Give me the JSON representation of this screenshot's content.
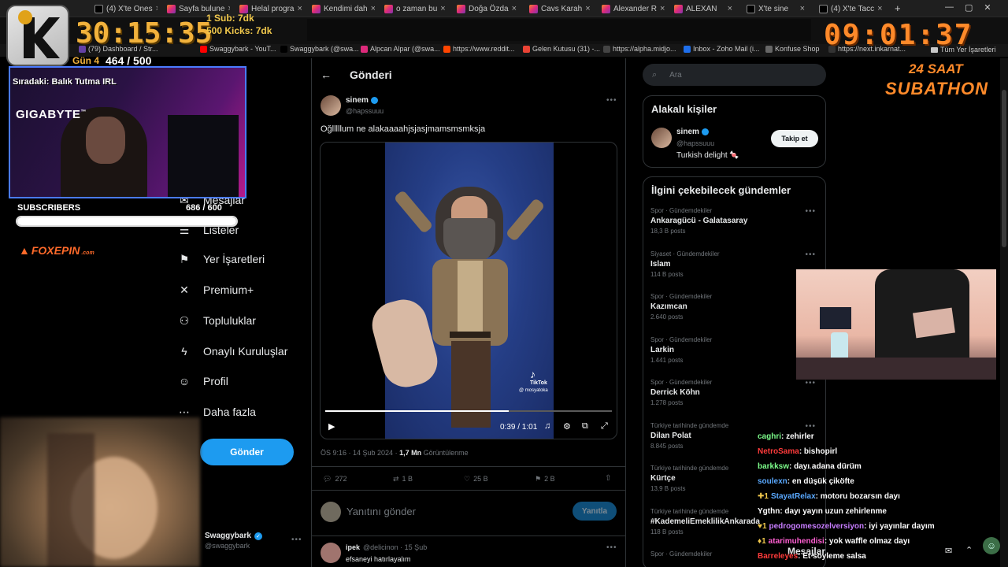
{
  "browser": {
    "tabs": [
      {
        "label": "(4) X'te Ones",
        "icon": "x"
      },
      {
        "label": "Sayfa bulune",
        "icon": "ig"
      },
      {
        "label": "Helal progra",
        "icon": "ig"
      },
      {
        "label": "Kendimi dah",
        "icon": "ig"
      },
      {
        "label": "o zaman bu",
        "icon": "ig"
      },
      {
        "label": "Doğa Özda",
        "icon": "ig"
      },
      {
        "label": "Cavs Karah",
        "icon": "ig"
      },
      {
        "label": "Alexander R",
        "icon": "ig"
      },
      {
        "label": "ALEXAN",
        "icon": "ig"
      },
      {
        "label": "X'te sine",
        "icon": "x"
      },
      {
        "label": "(4) X'te Tacc",
        "icon": "x"
      }
    ],
    "new_tab": "+",
    "bookmarks": [
      "(79) Dashboard / Str...",
      "Swaggybark - YouT...",
      "Swaggybark (@swa...",
      "Alpcan Alpar (@swa...",
      "https://www.reddit...",
      "Gelen Kutusu (31) -...",
      "https://alpha.midjo...",
      "Inbox - Zoho Mail (i...",
      "Konfuse Shop",
      "https://next.inkarnat..."
    ],
    "all_bookmarks": "Tüm Yer İşaretleri"
  },
  "stream": {
    "subathon_timer": "30:15:35",
    "sub_rule": "1 Sub: 7dk",
    "kick_rule": "500 Kicks: 7dk",
    "day_label": "Gün 4",
    "day_progress": "464 / 500",
    "clock": "09:01:37",
    "subathon_line1": "24 SAAT",
    "subathon_line2": "SUBATHON",
    "next_up": "Sıradaki: Balık Tutma IRL",
    "sponsor": "GIGABYTE",
    "sponsor_tm": "™",
    "subscribers_label": "SUBSCRIBERS",
    "subscribers_count": "686  /  600",
    "subscribers_fill": 1.0,
    "sponsor2": "FOXEPIN",
    "sponsor2_sub": ".com"
  },
  "x": {
    "nav": [
      {
        "label": "Mesajlar",
        "icon": "mail-icon"
      },
      {
        "label": "Listeler",
        "icon": "list-icon"
      },
      {
        "label": "Yer İşaretleri",
        "icon": "bookmark-icon"
      },
      {
        "label": "Premium+",
        "icon": "x-logo-icon"
      },
      {
        "label": "Topluluklar",
        "icon": "communities-icon"
      },
      {
        "label": "Onaylı Kuruluşlar",
        "icon": "lightning-icon"
      },
      {
        "label": "Profil",
        "icon": "profile-icon"
      },
      {
        "label": "Daha fazla",
        "icon": "more-icon"
      }
    ],
    "post_button": "Gönder",
    "account_name": "Swaggybark",
    "account_handle": "@swaggybark",
    "header_title": "Gönderi",
    "tweet": {
      "name": "sinem",
      "handle": "@hapssuuu",
      "text": "Oğlllllum ne alakaaaahjsjasjmamsmsmksja",
      "video_time": "0:39 / 1:01",
      "video_progress": 0.64,
      "tiktok_label": "TikTok",
      "tiktok_user": "@ mosyatoka",
      "timestamp": "ÖS 9:16 · 14 Şub 2024 · ",
      "views_count": "1,7 Mn",
      "views_label": " Görüntülenme",
      "replies": "272",
      "retweets": "1 B",
      "likes": "25 B",
      "bookmarks": "2 B"
    },
    "reply_placeholder": "Yanıtını gönder",
    "reply_button": "Yanıtla",
    "reply": {
      "name": "ipek",
      "handle": "@delicinon · 15 Şub",
      "text": "efsaneyi hatırlayalım"
    },
    "search_placeholder": "Ara",
    "related_title": "Alakalı kişiler",
    "related_user": {
      "name": "sinem",
      "handle": "@hapssuuu",
      "bio": "Turkish delight 🍬",
      "follow": "Takip et"
    },
    "trends_title": "İlgini çekebilecek gündemler",
    "trends": [
      {
        "cat": "Spor · Gündemdekiler",
        "name": "Ankaragücü - Galatasaray",
        "count": "18,3 B posts"
      },
      {
        "cat": "Siyaset · Gündemdekiler",
        "name": "Islam",
        "count": "114 B posts"
      },
      {
        "cat": "Spor · Gündemdekiler",
        "name": "Kazımcan",
        "count": "2.640 posts"
      },
      {
        "cat": "Spor · Gündemdekiler",
        "name": "Larkin",
        "count": "1.441 posts"
      },
      {
        "cat": "Spor · Gündemdekiler",
        "name": "Derrick Köhn",
        "count": "1.278 posts"
      },
      {
        "cat": "Türkiye tarihinde gündemde",
        "name": "Dilan Polat",
        "count": "8.845 posts"
      },
      {
        "cat": "Türkiye tarihinde gündemde",
        "name": "Kürtçe",
        "count": "13,9 B posts"
      },
      {
        "cat": "Türkiye tarihinde gündemde",
        "name": "#KademeliEmeklilikAnkarada",
        "count": "118 B posts"
      },
      {
        "cat": "Spor · Gündemdekiler",
        "name": "",
        "count": ""
      }
    ],
    "messages_label": "Mesajlar"
  },
  "chat": [
    {
      "user": "caghri",
      "msg": ": zehirler",
      "color": "#7cfc8a",
      "badge": ""
    },
    {
      "user": "NetroSama",
      "msg": ": bishopirl",
      "color": "#ff3b3b",
      "badge": ""
    },
    {
      "user": "barkksw",
      "msg": ": dayı adana dürüm",
      "color": "#7cfc8a",
      "badge": ""
    },
    {
      "user": "soulexn",
      "msg": ": en düşük çiköfte",
      "color": "#5aa9ff",
      "badge": ""
    },
    {
      "user": "StayatRelax",
      "msg": ": motoru bozarsın dayı",
      "color": "#5aa9ff",
      "badge": "✚1"
    },
    {
      "user": "Ygthn",
      "msg": ": dayı yayın uzun zehirlenme",
      "color": "#ffffff",
      "badge": ""
    },
    {
      "user": "pedrogomesozelversiyon",
      "msg": ": iyi yayınlar dayım",
      "color": "#c77dff",
      "badge": "♥1"
    },
    {
      "user": "atarimuhendisi",
      "msg": ": yok waffle olmaz dayı",
      "color": "#ff5fd2",
      "badge": "♦1"
    },
    {
      "user": "Barreleyes",
      "msg": ": Et söyleme salsa",
      "color": "#ff3b3b",
      "badge": ""
    }
  ]
}
